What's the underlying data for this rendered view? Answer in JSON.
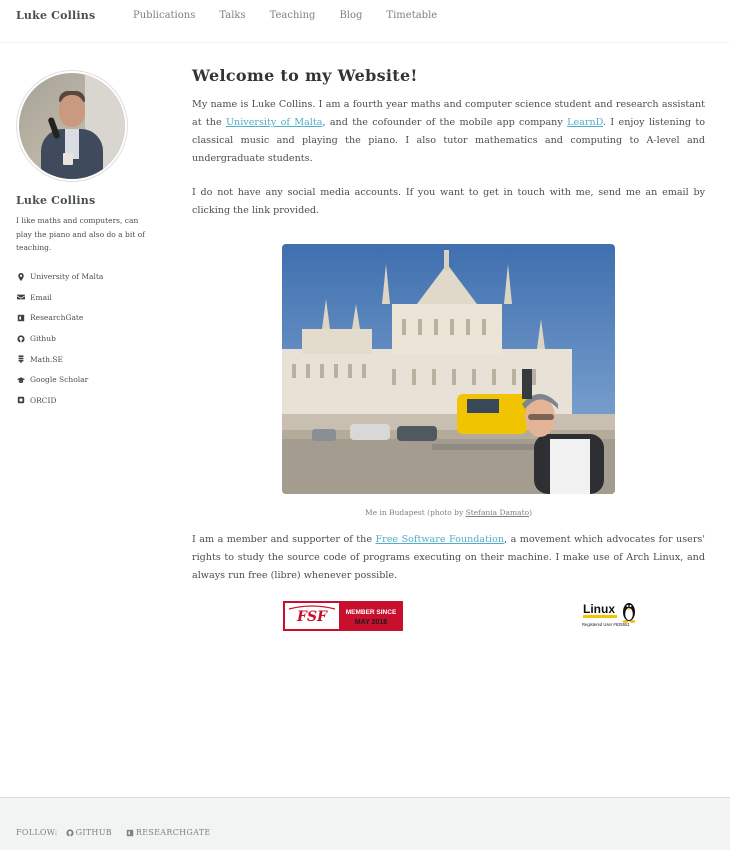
{
  "site": {
    "title": "Luke Collins"
  },
  "nav": [
    "Publications",
    "Talks",
    "Teaching",
    "Blog",
    "Timetable"
  ],
  "sidebar": {
    "name": "Luke Collins",
    "bio": "I like maths and computers, can play the piano and also do a bit of teaching.",
    "links": [
      {
        "label": "University of Malta",
        "icon": "map-marker-icon"
      },
      {
        "label": "Email",
        "icon": "envelope-icon"
      },
      {
        "label": "ResearchGate",
        "icon": "researchgate-icon"
      },
      {
        "label": "Github",
        "icon": "github-icon"
      },
      {
        "label": "Math.SE",
        "icon": "stack-exchange-icon"
      },
      {
        "label": "Google Scholar",
        "icon": "graduation-cap-icon"
      },
      {
        "label": "ORCID",
        "icon": "orcid-icon"
      }
    ]
  },
  "main": {
    "title": "Welcome to my Website!",
    "p1": {
      "t1": "My name is Luke Collins. I am a fourth year maths and computer science student and research assistant at the ",
      "link1": "University of Malta",
      "t2": ", and the cofounder of the mobile app company ",
      "link2": "LearnD",
      "t3": ". I enjoy listening to classical music and playing the piano. I also tutor mathematics and computing to A-level and undergraduate students."
    },
    "p2": "I do not have any social media accounts. If you want to get in touch with me, send me an email by clicking the link provided.",
    "caption": {
      "before": "Me in Budapest (photo by ",
      "link": "Stefania Damato",
      "after": ")"
    },
    "p3": {
      "t1": "I am a member and supporter of the ",
      "link": "Free Software Foundation",
      "t2": ", a movement which advocates for users' rights to study the source code of programs executing on their machine. I make use of Arch Linux, and always run free (libre) whenever possible."
    },
    "badges": {
      "fsf_line1": "MEMBER SINCE",
      "fsf_line2": "MAY 2018",
      "linux_title": "Linux",
      "linux_sub": "Registered User #625551"
    }
  },
  "footer": {
    "follow_label": "FOLLOW:",
    "links": [
      "GITHUB",
      "RESEARCHGATE"
    ]
  },
  "colors": {
    "link": "#52adc8",
    "text": "#494e52",
    "footer_bg": "#f2f3f3"
  }
}
